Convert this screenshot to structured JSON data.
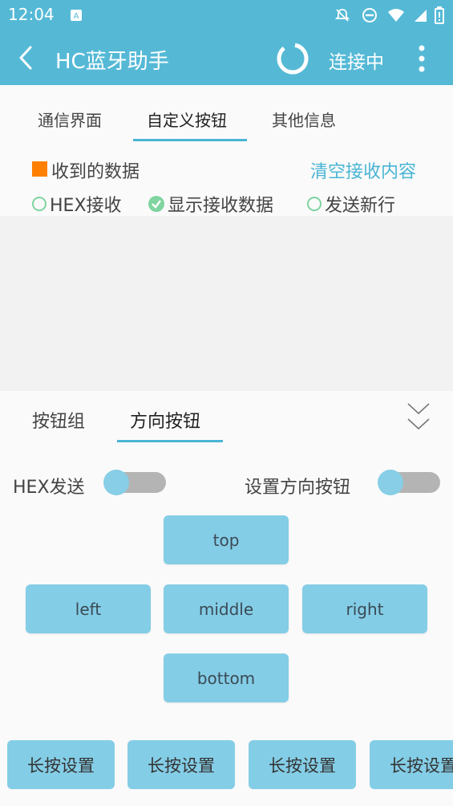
{
  "status_bar": {
    "time": "12:04"
  },
  "app_bar": {
    "title": "HC蓝牙助手",
    "connect_status": "连接中"
  },
  "top_tabs": [
    {
      "label": "通信界面"
    },
    {
      "label": "自定义按钮",
      "selected": true
    },
    {
      "label": "其他信息"
    }
  ],
  "receive": {
    "title": "收到的数据",
    "clear": "清空接收内容",
    "options": [
      {
        "label": "HEX接收",
        "checked": false
      },
      {
        "label": "显示接收数据",
        "checked": true
      },
      {
        "label": "发送新行",
        "checked": false
      }
    ]
  },
  "bottom_tabs": [
    {
      "label": "按钮组"
    },
    {
      "label": "方向按钮",
      "selected": true
    }
  ],
  "toggles": {
    "hex_send": {
      "label": "HEX发送",
      "on": false
    },
    "set_direction": {
      "label": "设置方向按钮",
      "on": false
    }
  },
  "direction_buttons": {
    "top": "top",
    "left": "left",
    "middle": "middle",
    "right": "right",
    "bottom": "bottom"
  },
  "long_press_buttons": [
    "长按设置",
    "长按设置",
    "长按设置",
    "长按设置"
  ],
  "colors": {
    "primary": "#55b9d6",
    "accent": "#49b5d4",
    "button": "#84cde6",
    "check": "#7fd4a0",
    "marker": "#ff8000"
  }
}
